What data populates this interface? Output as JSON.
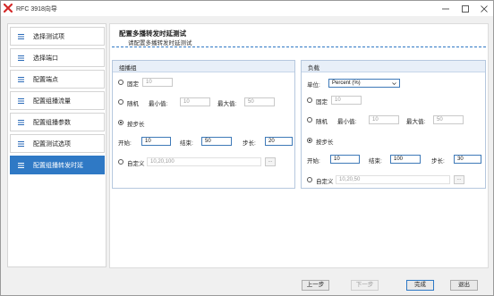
{
  "window": {
    "title": "RFC 3918向导"
  },
  "sidebar": {
    "items": [
      {
        "label": "选择测试项"
      },
      {
        "label": "选择端口"
      },
      {
        "label": "配置端点"
      },
      {
        "label": "配置组播流量"
      },
      {
        "label": "配置组播参数"
      },
      {
        "label": "配置测试选项"
      },
      {
        "label": "配置组播转发时延",
        "active": true
      }
    ]
  },
  "main": {
    "heading": "配置多播转发时延测试",
    "subheading": "请配置多播转发时延测试"
  },
  "multicast_group": {
    "title": "组播组",
    "fixed": {
      "label": "固定",
      "value": "10"
    },
    "random": {
      "label": "随机",
      "min_label": "最小值:",
      "min_value": "10",
      "max_label": "最大值:",
      "max_value": "50"
    },
    "step": {
      "label": "按步长",
      "start_label": "开始:",
      "start_value": "10",
      "end_label": "结束:",
      "end_value": "50",
      "step_label": "步长:",
      "step_value": "20"
    },
    "custom": {
      "label": "自定义",
      "value": "10,20,100",
      "browse": "..."
    }
  },
  "load": {
    "title": "负载",
    "unit_label": "单位:",
    "unit_value": "Percent (%)",
    "fixed": {
      "label": "固定",
      "value": "10"
    },
    "random": {
      "label": "随机",
      "min_label": "最小值:",
      "min_value": "10",
      "max_label": "最大值:",
      "max_value": "50"
    },
    "step": {
      "label": "按步长",
      "start_label": "开始:",
      "start_value": "10",
      "end_label": "结束:",
      "end_value": "100",
      "step_label": "步长:",
      "step_value": "30"
    },
    "custom": {
      "label": "自定义",
      "value": "10,20,50",
      "browse": "..."
    }
  },
  "footer": {
    "prev": "上一步",
    "next": "下一步",
    "finish": "完成",
    "exit": "退出"
  },
  "selected_mode": {
    "multicast_group": "step",
    "load": "step"
  }
}
